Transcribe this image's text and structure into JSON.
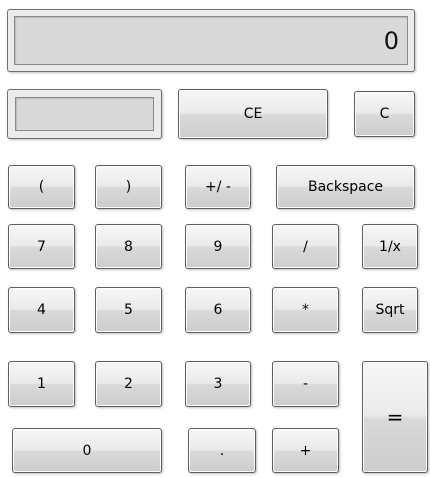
{
  "display": {
    "value": "0"
  },
  "memory": {
    "value": ""
  },
  "buttons": {
    "ce": "CE",
    "c": "C",
    "open_paren": "(",
    "close_paren": ")",
    "negate": "+/ -",
    "backspace": "Backspace",
    "seven": "7",
    "eight": "8",
    "nine": "9",
    "divide": "/",
    "reciprocal": "1/x",
    "four": "4",
    "five": "5",
    "six": "6",
    "multiply": "*",
    "sqrt": "Sqrt",
    "one": "1",
    "two": "2",
    "three": "3",
    "minus": "-",
    "equals": "=",
    "zero": "0",
    "decimal": ".",
    "plus": "+"
  }
}
